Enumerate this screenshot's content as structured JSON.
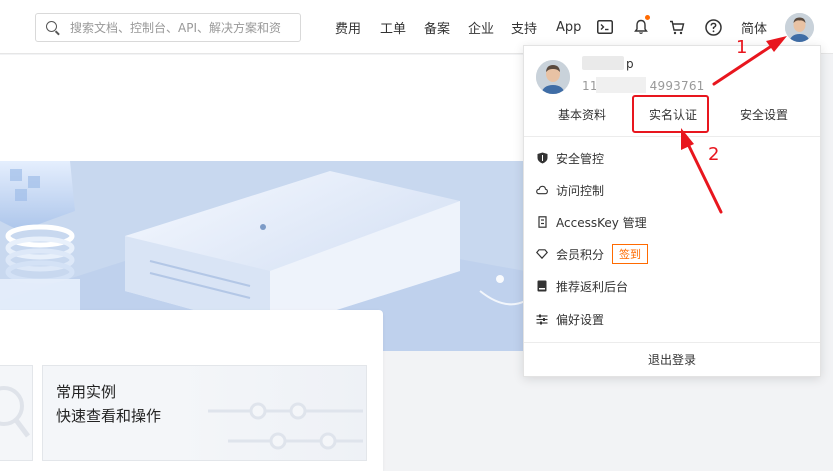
{
  "search": {
    "placeholder": "搜索文档、控制台、API、解决方案和资"
  },
  "nav": {
    "items": [
      "费用",
      "工单",
      "备案",
      "企业",
      "支持",
      "App"
    ],
    "language": "简体"
  },
  "icons": {
    "search": "search-icon",
    "terminal": "terminal-icon",
    "bell": "bell-icon",
    "cart": "cart-icon",
    "help": "help-icon",
    "avatar": "avatar"
  },
  "colors": {
    "accent": "#ff6a00",
    "annotation": "#e8161e"
  },
  "user_menu": {
    "username_visible": "p",
    "account_id_prefix": "11",
    "account_id_suffix": "4993761",
    "tabs": [
      "基本资料",
      "实名认证",
      "安全设置"
    ],
    "items": [
      {
        "label": "安全管控",
        "icon": "shield-icon"
      },
      {
        "label": "访问控制",
        "icon": "cloud-icon"
      },
      {
        "label": "AccessKey 管理",
        "icon": "key-icon"
      },
      {
        "label": "会员积分",
        "icon": "diamond-icon",
        "badge": "签到"
      },
      {
        "label": "推荐返利后台",
        "icon": "book-icon"
      },
      {
        "label": "偏好设置",
        "icon": "sliders-icon"
      }
    ],
    "logout": "退出登录"
  },
  "cards": {
    "instance_title": "常用实例",
    "instance_subtitle": "快速查看和操作"
  },
  "annotations": {
    "step1": "1",
    "step2": "2"
  }
}
